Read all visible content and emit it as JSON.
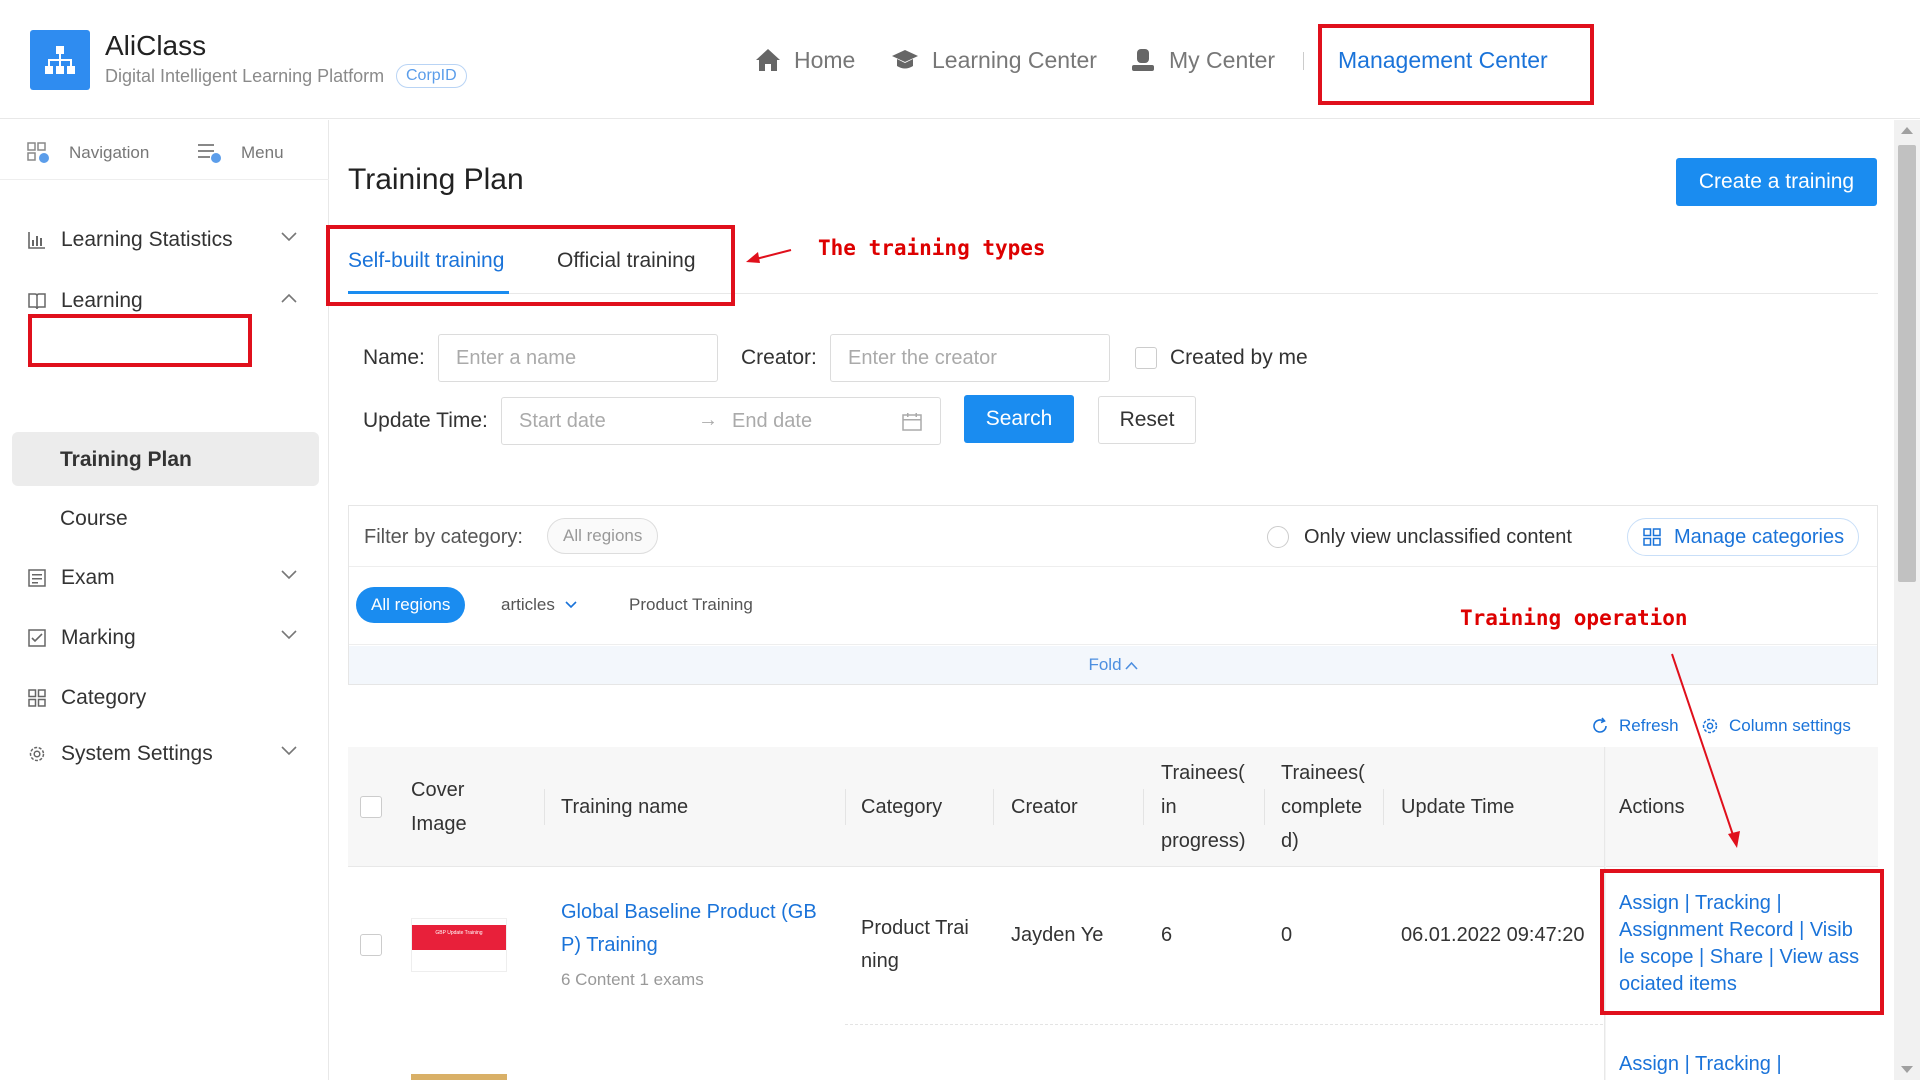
{
  "header": {
    "app_title": "AliClass",
    "app_subtitle": "Digital Intelligent Learning Platform",
    "corp_badge": "CorpID",
    "nav": {
      "home": "Home",
      "learning_center": "Learning Center",
      "my_center": "My Center",
      "management_center": "Management Center"
    }
  },
  "sidebar": {
    "top": {
      "navigation": "Navigation",
      "menu": "Menu"
    },
    "items": [
      {
        "label": "Learning Statistics",
        "icon": "chart-icon",
        "expanded": false
      },
      {
        "label": "Learning",
        "icon": "book-icon",
        "expanded": true
      },
      {
        "label": "Exam",
        "icon": "exam-icon",
        "expanded": false
      },
      {
        "label": "Marking",
        "icon": "marking-icon",
        "expanded": false
      },
      {
        "label": "Category",
        "icon": "grid-icon"
      },
      {
        "label": "System Settings",
        "icon": "gear-icon",
        "expanded": false
      }
    ],
    "sub_items": [
      {
        "label": "Training Plan",
        "active": true
      },
      {
        "label": "Course",
        "active": false
      }
    ]
  },
  "main": {
    "title": "Training Plan",
    "create_button": "Create a training",
    "tabs": [
      {
        "label": "Self-built training",
        "active": true
      },
      {
        "label": "Official training",
        "active": false
      }
    ],
    "filters": {
      "name_label": "Name:",
      "name_placeholder": "Enter a name",
      "creator_label": "Creator:",
      "creator_placeholder": "Enter the creator",
      "created_by_me": "Created by me",
      "update_time_label": "Update Time:",
      "start_date": "Start date",
      "end_date": "End date",
      "search": "Search",
      "reset": "Reset"
    },
    "category_filter": {
      "label": "Filter by category:",
      "all_regions_pill": "All regions",
      "unclassified": "Only view unclassified content",
      "manage": "Manage categories",
      "chips": [
        "All regions",
        "articles",
        "Product Training"
      ],
      "fold": "Fold"
    },
    "table_tools": {
      "refresh": "Refresh",
      "column_settings": "Column settings"
    },
    "columns": [
      "Cover Image",
      "Training name",
      "Category",
      "Creator",
      "Trainees( in progress)",
      "Trainees( complete d)",
      "Update Time",
      "Actions"
    ],
    "rows": [
      {
        "cover_text": "GBP Update Training",
        "name": "Global Baseline Product (GB P) Training",
        "subinfo": "6 Content 1 exams",
        "category": "Product Trai ning",
        "creator": "Jayden Ye",
        "in_progress": "6",
        "completed": "0",
        "update_time": "06.01.2022 09:47:20",
        "actions": "Assign | Tracking | Assignment Record | Visib le scope | Share | View ass ociated items"
      },
      {
        "actions": "Assign | Tracking |"
      }
    ]
  },
  "annotations": {
    "training_types": "The training types",
    "training_operation": "Training operation"
  },
  "colors": {
    "accent": "#1a8cf0",
    "link": "#1a73d9",
    "annotation_red": "#e0101c"
  }
}
